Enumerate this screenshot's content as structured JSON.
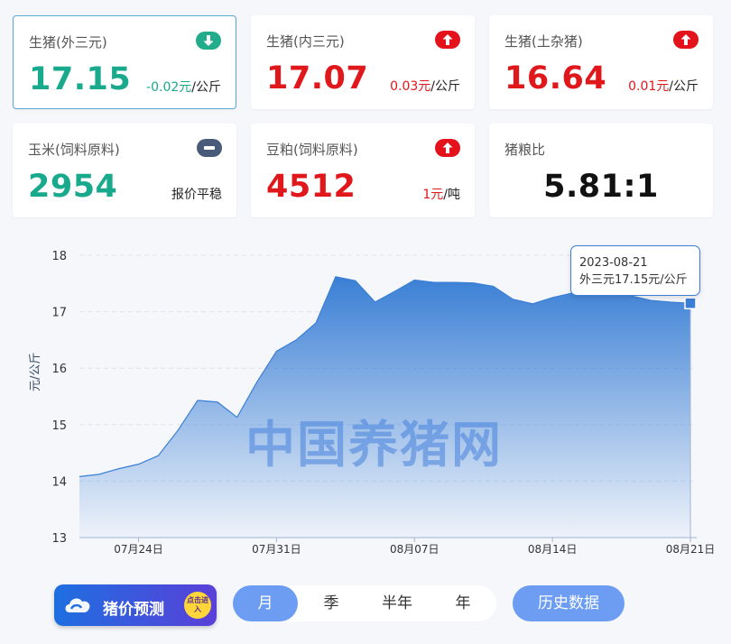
{
  "cards": [
    {
      "title": "生猪(外三元)",
      "value": "17.15",
      "change": "-0.02元",
      "unit": "/公斤",
      "trend": "down",
      "color": "#19a98c"
    },
    {
      "title": "生猪(内三元)",
      "value": "17.07",
      "change": "0.03元",
      "unit": "/公斤",
      "trend": "up",
      "color": "#e0171b"
    },
    {
      "title": "生猪(土杂猪)",
      "value": "16.64",
      "change": "0.01元",
      "unit": "/公斤",
      "trend": "up",
      "color": "#e0171b"
    },
    {
      "title": "玉米(饲料原料)",
      "value": "2954",
      "change": "报价平稳",
      "unit": "",
      "trend": "flat",
      "color": "#19a98c"
    },
    {
      "title": "豆粕(饲料原料)",
      "value": "4512",
      "change": "1元",
      "unit": "/吨",
      "trend": "up",
      "color": "#e0171b"
    },
    {
      "title": "猪粮比",
      "value": "5.81:1"
    }
  ],
  "chart_data": {
    "type": "area",
    "ylabel": "元/公斤",
    "ylim": [
      13,
      18
    ],
    "yticks": [
      13,
      14,
      15,
      16,
      17,
      18
    ],
    "xtick_labels": [
      "07月24日",
      "07月31日",
      "08月07日",
      "08月14日",
      "08月21日"
    ],
    "x": [
      "07-21",
      "07-22",
      "07-23",
      "07-24",
      "07-25",
      "07-26",
      "07-27",
      "07-28",
      "07-29",
      "07-30",
      "07-31",
      "08-01",
      "08-02",
      "08-03",
      "08-04",
      "08-05",
      "08-06",
      "08-07",
      "08-08",
      "08-09",
      "08-10",
      "08-11",
      "08-12",
      "08-13",
      "08-14",
      "08-15",
      "08-16",
      "08-17",
      "08-18",
      "08-19",
      "08-20",
      "08-21"
    ],
    "values": [
      14.08,
      14.12,
      14.22,
      14.3,
      14.45,
      14.9,
      15.43,
      15.4,
      15.13,
      15.75,
      16.3,
      16.5,
      16.8,
      17.62,
      17.55,
      17.17,
      17.36,
      17.56,
      17.52,
      17.52,
      17.51,
      17.45,
      17.22,
      17.14,
      17.25,
      17.33,
      17.4,
      17.35,
      17.28,
      17.2,
      17.17,
      17.15
    ],
    "color": "#3a7fd5",
    "grid": true
  },
  "watermark": "中国养猪网",
  "tooltip": {
    "date": "2023-08-21",
    "text": "外三元17.15元/公斤"
  },
  "promo": {
    "label": "猪价预测",
    "badge": "点击进入"
  },
  "periods": [
    "月",
    "季",
    "半年",
    "年"
  ],
  "active_period": "月",
  "history_label": "历史数据"
}
